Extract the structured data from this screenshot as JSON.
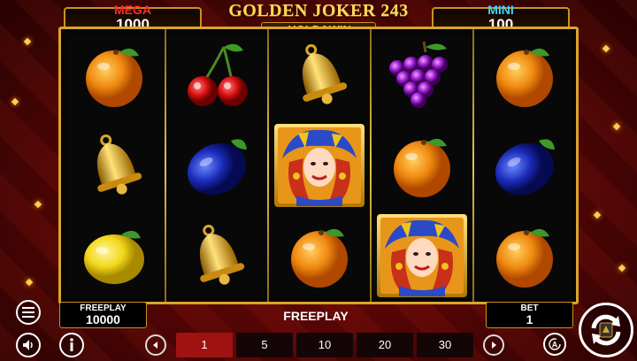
{
  "jackpots": {
    "mega": {
      "label": "MEGA",
      "value": "1000"
    },
    "mini": {
      "label": "MINI",
      "value": "100"
    }
  },
  "title": {
    "line1": "GOLDEN JOKER 243",
    "line2": "HOLD&WIN"
  },
  "reels": [
    [
      "orange",
      "bell",
      "lemon"
    ],
    [
      "cherry",
      "plum",
      "bell"
    ],
    [
      "bell",
      "joker",
      "orange"
    ],
    [
      "grapes",
      "orange",
      "joker"
    ],
    [
      "orange",
      "plum",
      "orange"
    ]
  ],
  "freeplay_panel": {
    "label": "FREEPLAY",
    "value": "10000"
  },
  "status": "FREEPLAY",
  "bet_panel": {
    "label": "BET",
    "value": "1"
  },
  "bet_options": {
    "values": [
      "1",
      "5",
      "10",
      "20",
      "30"
    ],
    "selected": "1"
  },
  "icons": {
    "menu": "menu-icon",
    "sound": "speaker-icon",
    "info": "info-icon",
    "auto": "autoplay-icon",
    "spin": "spin-icon",
    "prev": "chevron-left-icon",
    "next": "chevron-right-icon"
  },
  "colors": {
    "frame": "#d9a52a",
    "mega": "#ff2a2a",
    "mini": "#3fd6ff",
    "bet_selected": "#a01212"
  }
}
